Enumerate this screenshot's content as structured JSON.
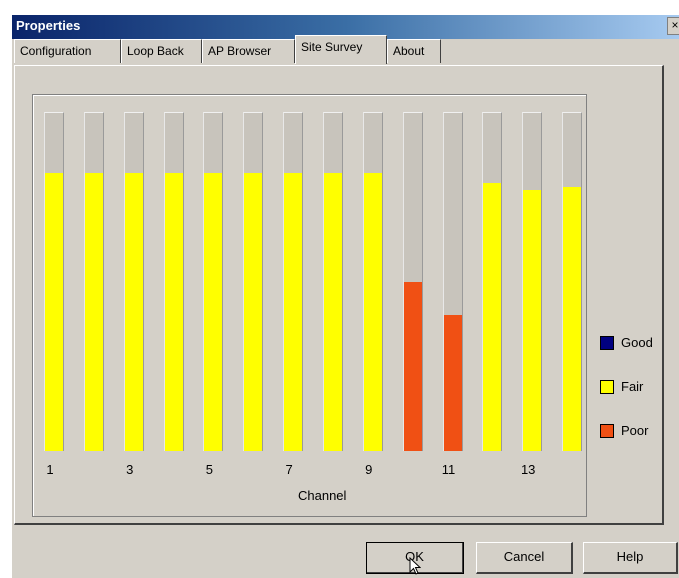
{
  "window": {
    "title": "Properties",
    "close_glyph": "×"
  },
  "tabs": [
    {
      "label": "Configuration",
      "active": false
    },
    {
      "label": "Loop Back",
      "active": false
    },
    {
      "label": "AP Browser",
      "active": false
    },
    {
      "label": "Site Survey",
      "active": true
    },
    {
      "label": "About",
      "active": false
    }
  ],
  "legend": [
    {
      "label": "Good",
      "color": "#000080"
    },
    {
      "label": "Fair",
      "color": "#ffff00"
    },
    {
      "label": "Poor",
      "color": "#f05014"
    }
  ],
  "buttons": {
    "ok": "OK",
    "cancel": "Cancel",
    "help": "Help"
  },
  "chart_data": {
    "type": "bar",
    "xlabel": "Channel",
    "categories": [
      "1",
      "2",
      "3",
      "4",
      "5",
      "6",
      "7",
      "8",
      "9",
      "10",
      "11",
      "12",
      "13",
      "14"
    ],
    "tick_labels": [
      "1",
      "",
      "3",
      "",
      "5",
      "",
      "7",
      "",
      "9",
      "",
      "11",
      "",
      "13",
      ""
    ],
    "values": [
      82,
      82,
      82,
      82,
      82,
      82,
      82,
      82,
      82,
      50,
      40,
      79,
      77,
      78
    ],
    "quality": [
      "Fair",
      "Fair",
      "Fair",
      "Fair",
      "Fair",
      "Fair",
      "Fair",
      "Fair",
      "Fair",
      "Poor",
      "Poor",
      "Fair",
      "Fair",
      "Fair"
    ],
    "ylim": [
      0,
      100
    ],
    "grid": false,
    "legend_position": "right"
  }
}
